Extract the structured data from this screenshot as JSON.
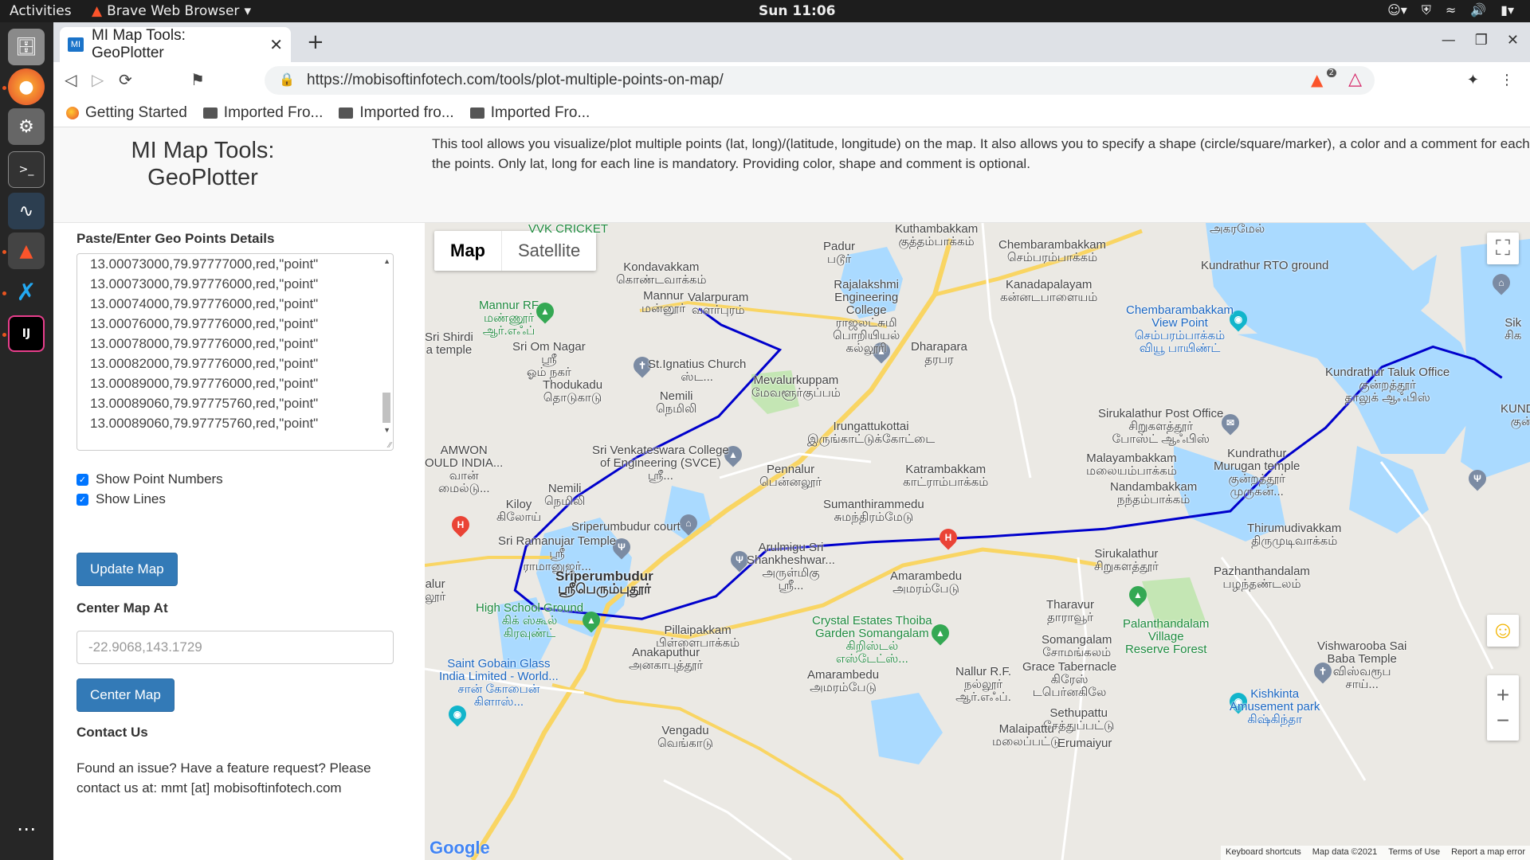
{
  "system": {
    "activities": "Activities",
    "app_name": "Brave Web Browser",
    "clock": "Sun 11:06"
  },
  "browser": {
    "tab_title": "MI Map Tools: GeoPlotter",
    "tab_favicon": "MI",
    "url": "https://mobisoftinfotech.com/tools/plot-multiple-points-on-map/",
    "shield_badge": "2",
    "bookmarks": [
      "Getting Started",
      "Imported Fro...",
      "Imported fro...",
      "Imported Fro..."
    ]
  },
  "page": {
    "title_line1": "MI Map Tools:",
    "title_line2": "GeoPlotter",
    "intro": "This tool allows you visualize/plot multiple points (lat, long)/(latitude, longitude) on the map. It also allows you to specify a shape (circle/square/marker), a color and a comment for each of the points. Only lat, long for each line is mandatory. Providing color, shape and comment is optional.",
    "points_label": "Paste/Enter Geo Points Details",
    "points": [
      "13.00073000,79.97777000,red,\"point\"",
      "13.00073000,79.97776000,red,\"point\"",
      "13.00074000,79.97776000,red,\"point\"",
      "13.00076000,79.97776000,red,\"point\"",
      "13.00078000,79.97776000,red,\"point\"",
      "13.00082000,79.97776000,red,\"point\"",
      "13.00089000,79.97776000,red,\"point\"",
      "13.00089060,79.97775760,red,\"point\"",
      "13.00089060,79.97775760,red,\"point\""
    ],
    "show_point_numbers": "Show Point Numbers",
    "show_lines": "Show Lines",
    "update_map": "Update Map",
    "center_label": "Center Map At",
    "center_placeholder": "-22.9068,143.1729",
    "center_button": "Center Map",
    "contact_heading": "Contact Us",
    "contact_text": "Found an issue? Have a feature request? Please contact us at: mmt [at] mobisoftinfotech.com"
  },
  "map": {
    "type_map": "Map",
    "type_satellite": "Satellite",
    "footer": [
      "Keyboard shortcuts",
      "Map data ©2021",
      "Terms of Use",
      "Report a map error"
    ],
    "google": "Google",
    "places": [
      {
        "t": "Kuthambakkam\nகுத்தம்பாக்கம்"
      },
      {
        "t": "Chembarambakkam\nசெம்பரம்பாக்கம்"
      },
      {
        "t": "Padur\nபடூர்"
      },
      {
        "t": "Kondavakkam\nகொண்டவாக்கம்"
      },
      {
        "t": "Mannur RF\nமண்ணூர்\nஆர்.எஃப்",
        "c": "green"
      },
      {
        "t": "Mannur\nமன்னூர்"
      },
      {
        "t": "Valarpuram\nவளர்புரம்"
      },
      {
        "t": "Rajalakshmi\nEngineering\nCollege\nராஜலட்சுமி\nபொறியியல்\nகல்லூரி"
      },
      {
        "t": "Kanadapalayam\nகன்னடபாளையம்"
      },
      {
        "t": "Kundrathur RTO ground"
      },
      {
        "t": "Chembarambakkam\nView Point\nசெம்பரம்பாக்கம்\nவியூ பாயிண்ட்",
        "c": "blue"
      },
      {
        "t": "Sri Shirdi\na temple"
      },
      {
        "t": "Sri Om Nagar\nஸ்ரீ\nஓம் நகர்"
      },
      {
        "t": "St.Ignatius Church\nஸ்ட..."
      },
      {
        "t": "Dharapara\nதரபர"
      },
      {
        "t": "Thodukadu\nதொடுகாடு"
      },
      {
        "t": "Mevalurkuppam\nமேவளூர்குப்பம்"
      },
      {
        "t": "Nemili\nநெமிலி"
      },
      {
        "t": "Kundrathur Taluk Office\nகுன்றத்தூர்\nதாலுக் ஆஃபிஸ்"
      },
      {
        "t": "Sirukalathur Post Office\nசிறுகளத்தூர்\nபோஸ்ட் ஆஃபிஸ்"
      },
      {
        "t": "Irungattukottai\nஇருங்காட்டுக்கோட்டை"
      },
      {
        "t": "Sri Venkateswara College\nof Engineering (SVCE)\nஸ்ரீ..."
      },
      {
        "t": "AMWON\nOULD INDIA...\nவான்\nமைல்டு..."
      },
      {
        "t": "Pennalur\nபென்னலூர்"
      },
      {
        "t": "Katrambakkam\nகாட்ராம்பாக்கம்"
      },
      {
        "t": "Malayambakkam\nமலையம்பாக்கம்"
      },
      {
        "t": "Kundrathur\nMurugan temple\nகுன்றத்தூர்\nமுருகன்..."
      },
      {
        "t": "Nandambakkam\nநந்தம்பாக்கம்"
      },
      {
        "t": "Kiloy\nகிலோய்"
      },
      {
        "t": "Nemili\nநெமிலி"
      },
      {
        "t": "Sumanthirammedu\nசுமந்திரம்மேடு"
      },
      {
        "t": "Sriperumbudur court"
      },
      {
        "t": "Sri Ramanujar Temple\nஸ்ரீ\nராமானுஜர்..."
      },
      {
        "t": "Arulmigu Sri\nShankheshwar...\nஅருள்மிகு\nஸ்ரீ..."
      },
      {
        "t": "Sirukalathur\nசிறுகளத்தூர்"
      },
      {
        "t": "Thirumudivakkam\nதிருமுடிவாக்கம்"
      },
      {
        "t": "Pazhanthandalam\nபழந்தண்டலம்"
      },
      {
        "t": "Amarambedu\nஅமரம்பேடு"
      },
      {
        "t": "Sriperumbudur\nஸ்ரீபெரும்புதூர்",
        "c": "dark"
      },
      {
        "t": "High School Ground\nகிக் ஸ்கூல்\nகிரவுண்ட்",
        "c": "green"
      },
      {
        "t": "Pillaipakkam\nபிள்ளைபாக்கம்"
      },
      {
        "t": "Crystal Estates Thoiba\nGarden Somangalam\nகிறிஸ்டல்\nஎஸ்டேட்ஸ்...",
        "c": "green"
      },
      {
        "t": "Tharavur\nதாராவூர்"
      },
      {
        "t": "Somangalam\nசோமங்கலம்"
      },
      {
        "t": "Palanthandalam\nVillage\nReserve Forest",
        "c": "green"
      },
      {
        "t": "Vishwarooba Sai\nBaba Temple\nவிஸ்வரூப\nசாய்..."
      },
      {
        "t": "Anakaputhur\nஅனகாபுத்தூர்"
      },
      {
        "t": "Saint Gobain Glass\nIndia Limited - World...\nசான் கோபைன்\nகிளாஸ்...",
        "c": "blue"
      },
      {
        "t": "Amarambedu\nஅமரம்பேடு"
      },
      {
        "t": "Nallur R.F.\nநல்லூர்\nஆர்.எஃப்."
      },
      {
        "t": "Grace Tabernacle\nகிரேஸ்\nடபெர்னகிலே"
      },
      {
        "t": "Kishkinta\nAmusement park\nகிஷ்கிந்தா",
        "c": "blue"
      },
      {
        "t": "Sethupattu\nசேத்துப்பட்டு"
      },
      {
        "t": "Vengadu\nவெங்காடு"
      },
      {
        "t": "Malaipattu\nமலைப்பட்டு"
      },
      {
        "t": "Erumaiyur"
      },
      {
        "t": "VVK CRICKET",
        "c": "green"
      },
      {
        "t": "அகரமேல்"
      },
      {
        "t": "KUNDRA\nகுன்ற"
      },
      {
        "t": "alur\nலூர்"
      },
      {
        "t": "Sik\nசிக"
      }
    ],
    "route_points": [
      [
        13.0461,
        79.9512
      ],
      [
        13.0434,
        79.9538
      ],
      [
        13.0392,
        79.9607
      ],
      [
        13.028,
        79.9535
      ],
      [
        13.0212,
        79.944
      ],
      [
        13.0145,
        79.9368
      ],
      [
        13.0062,
        79.9309
      ],
      [
        12.9988,
        79.9296
      ],
      [
        12.9958,
        79.9322
      ],
      [
        12.994,
        79.9445
      ],
      [
        12.9978,
        79.9532
      ],
      [
        13.0056,
        79.9592
      ],
      [
        13.0069,
        79.9715
      ],
      [
        13.0078,
        79.9851
      ],
      [
        13.0091,
        79.9988
      ],
      [
        13.0121,
        80.0136
      ],
      [
        13.0202,
        80.0192
      ],
      [
        13.0261,
        80.0248
      ],
      [
        13.0363,
        80.0314
      ],
      [
        13.0397,
        80.0374
      ],
      [
        13.0376,
        80.0423
      ],
      [
        13.0345,
        80.0455
      ]
    ],
    "colors": {
      "route": "#0000cc",
      "water": "#aadaff",
      "park": "#c4e6b4",
      "highway": "#f9d563",
      "road": "#ffffff",
      "badge_green": "#0b8a44"
    }
  }
}
